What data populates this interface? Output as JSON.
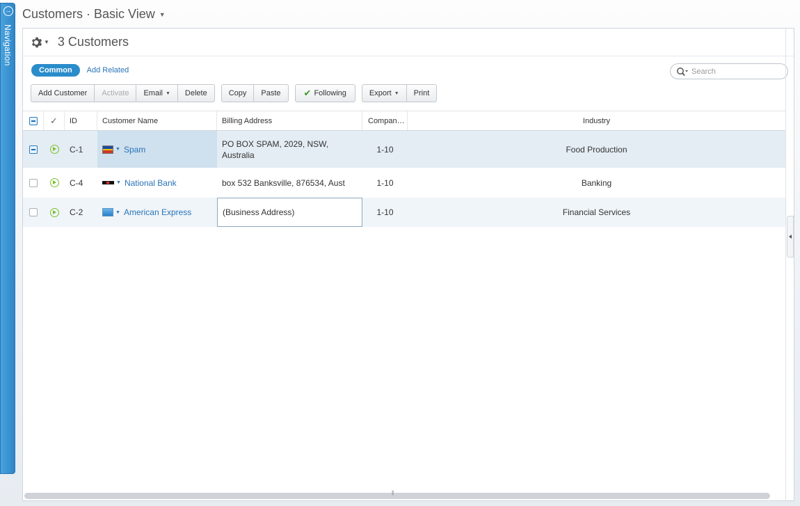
{
  "navigation": {
    "label": "Navigation",
    "icon": "circle-arrow-icon"
  },
  "page": {
    "title": "Customers · Basic View"
  },
  "panel": {
    "title": "3 Customers"
  },
  "tabs": {
    "active": "Common",
    "other": "Add Related"
  },
  "search": {
    "placeholder": "Search"
  },
  "toolbar": {
    "add_customer": "Add Customer",
    "activate": "Activate",
    "email": "Email",
    "delete": "Delete",
    "copy": "Copy",
    "paste": "Paste",
    "following": "Following",
    "export": "Export",
    "print": "Print"
  },
  "grid": {
    "columns": {
      "id": "ID",
      "name": "Customer Name",
      "address": "Billing Address",
      "company": "Compan…",
      "industry": "Industry"
    },
    "rows": [
      {
        "id": "C-1",
        "name": "Spam",
        "address": "PO BOX SPAM, 2029, NSW, Australia",
        "company": "1-10",
        "industry": "Food Production",
        "logo": "spam-logo"
      },
      {
        "id": "C-4",
        "name": "National Bank",
        "address": "box 532 Banksville, 876534, Aust",
        "company": "1-10",
        "industry": "Banking",
        "logo": "bank-logo"
      },
      {
        "id": "C-2",
        "name": "American Express",
        "address": "(Business Address)",
        "company": "1-10",
        "industry": "Financial Services",
        "logo": "amex-logo"
      }
    ]
  },
  "colors": {
    "accent": "#2a8ccb",
    "link": "#2a73b8",
    "selected_row": "#e4edf4",
    "nav": "#2e86c8",
    "activity": "#7cbf2a"
  }
}
